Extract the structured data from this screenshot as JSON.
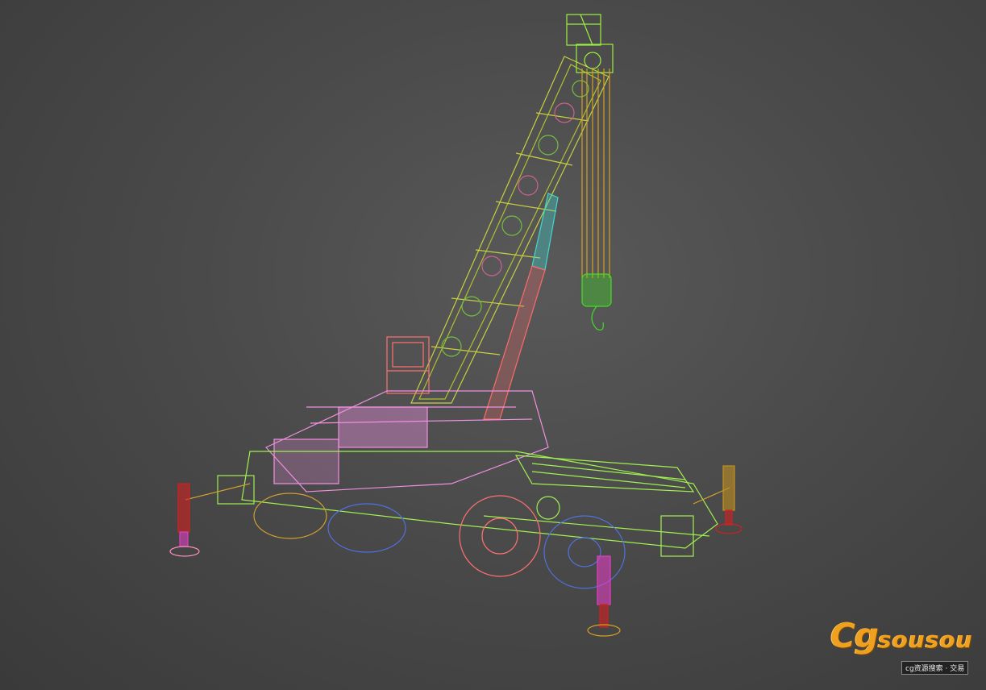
{
  "viewport": {
    "render_mode": "wireframe",
    "background": "#4a4a4a",
    "object_colors": {
      "boom": "#c8d040",
      "boom_tip": "#9cf040",
      "hook": "#40e020",
      "hoist_cable": "#d8a020",
      "cylinder_upper": "#40d8d0",
      "cylinder_lower": "#ff6a6a",
      "cab": "#ff7070",
      "chassis": "#a0f050",
      "superstructure": "#f090e0",
      "wheel_front": "#5070e0",
      "wheel_rear": "#ff7070",
      "wheel_left": "#d0a030",
      "outrigger_left": "#d02020",
      "outrigger_front": "#e040c0",
      "outrigger_right": "#c09020",
      "pad": "#ff90c0"
    }
  },
  "watermark": {
    "logo_big": "Cg",
    "logo_small": "sousou",
    "tagline": "cg资源搜索 · 交易"
  }
}
